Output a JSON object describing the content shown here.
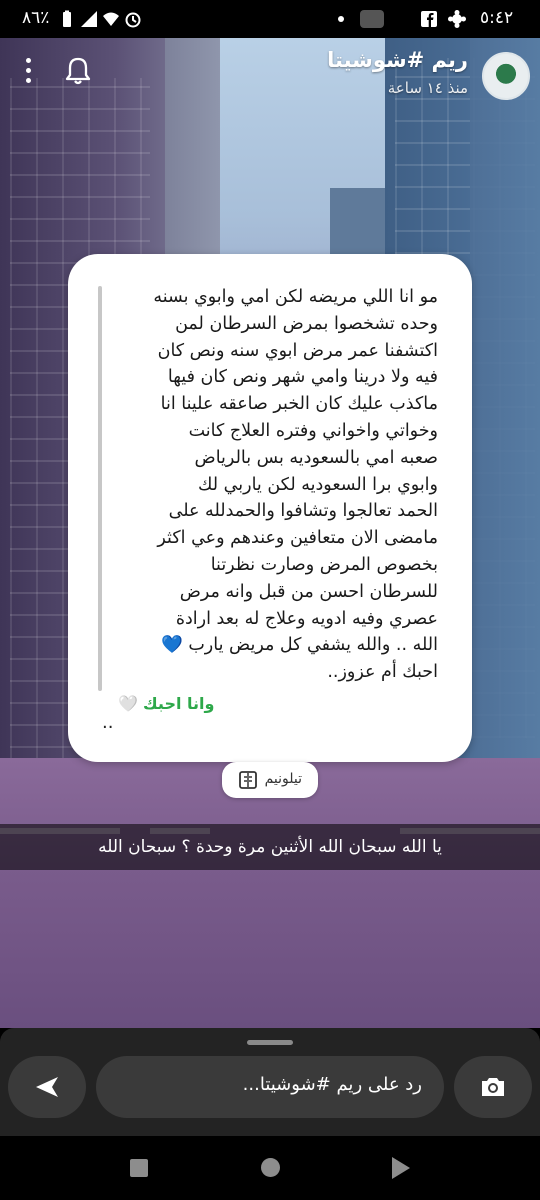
{
  "status_bar": {
    "time": "٥:٤٢",
    "battery": "٨٦٪"
  },
  "story": {
    "author_name": "ريم #شوشيتا",
    "time_ago": "منذ ١٤ ساعة"
  },
  "quote": {
    "lines": [
      "مو انا اللي مريضه لكن امي وابوي بسنه",
      "وحده تشخصوا بمرض السرطان لمن",
      "اكتشفنا عمر مرض ابوي سنه ونص كان",
      "فيه ولا درينا وامي شهر ونص كان فيها",
      "ماكذب عليك كان الخبر صاعقه علينا انا",
      "وخواتي واخواني وفتره العلاج كانت",
      "صعبه امي بالسعوديه بس بالرياض",
      "وابوي برا السعوديه لكن ياربي لك",
      "الحمد تعالجوا وتشافوا والحمدلله على",
      "مامضى الان متعافين وعندهم وعي اكثر",
      "بخصوص المرض وصارت نظرتنا",
      "للسرطان احسن من قبل وانه مرض",
      "عصري وفيه ادويه وعلاج له بعد ارادة",
      "الله .. والله يشفي كل مريض يارب 💙",
      "احبك أم عزوز.."
    ],
    "love_text": "وانا احبك",
    "love_heart": "🤍",
    "trailing_dots": ".."
  },
  "source_label": "تيلونيم",
  "caption": "يا الله سبحان الله الأثنين مرة وحدة ؟ سبحان الله",
  "reply": {
    "placeholder": "رد على ريم #شوشيتا..."
  },
  "colors": {
    "accent_green": "#2ea84a",
    "bottom_bar": "#232323"
  },
  "icons": [
    "menu-dots-icon",
    "bell-icon",
    "book-icon",
    "send-icon",
    "camera-icon",
    "wifi-icon",
    "signal-icon",
    "alarm-icon",
    "battery-icon",
    "facebook-icon",
    "settings-icon"
  ]
}
